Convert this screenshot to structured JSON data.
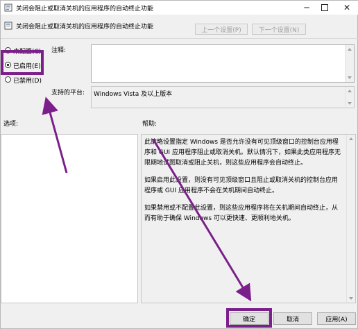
{
  "window": {
    "title": "关闭会阻止或取消关机的应用程序的自动终止功能",
    "policy_title": "关闭会阻止或取消关机的应用程序的自动终止功能"
  },
  "nav": {
    "prev_label": "上一个设置(P)",
    "next_label": "下一个设置(N)"
  },
  "options_state": {
    "not_configured": "未配置(C)",
    "enabled": "已启用(E)",
    "disabled": "已禁用(D)",
    "selected": "enabled"
  },
  "comment": {
    "label": "注释:",
    "value": ""
  },
  "supported": {
    "label": "支持的平台:",
    "value": "Windows Vista 及以上版本"
  },
  "sections": {
    "options_label": "选项:",
    "help_label": "帮助:"
  },
  "help_text": {
    "p1": "此策略设置指定 Windows 是否允许没有可见顶级窗口的控制台应用程序和 GUI 应用程序阻止或取消关机。默认情况下，如果此类应用程序无限期地试图取消或阻止关机，则这些应用程序会自动终止。",
    "p2": "如果启用此设置，则没有可见顶级窗口且阻止或取消关机的控制台应用程序或 GUI 应用程序不会在关机期间自动终止。",
    "p3": "如果禁用或不配置此设置，则这些应用程序将在关机期间自动终止，从而有助于确保 Windows 可以更快速、更顺利地关机。"
  },
  "footer": {
    "ok_label": "确定",
    "cancel_label": "取消",
    "apply_label": "应用(A)"
  },
  "annotation": {
    "color": "#7b1f8a"
  }
}
